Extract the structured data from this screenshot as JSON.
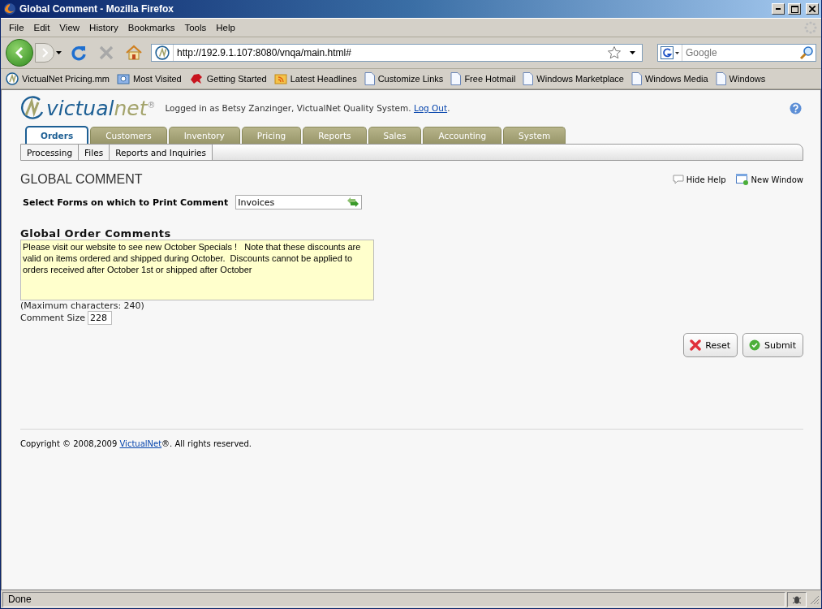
{
  "window": {
    "title": "Global Comment - Mozilla Firefox"
  },
  "menu": [
    "File",
    "Edit",
    "View",
    "History",
    "Bookmarks",
    "Tools",
    "Help"
  ],
  "address": {
    "value": "http://192.9.1.107:8080/vnqa/main.html#"
  },
  "search": {
    "placeholder": "Google"
  },
  "bookmarks": [
    {
      "kind": "logo",
      "label": "VictualNet Pricing.mm"
    },
    {
      "kind": "folder",
      "label": "Most Visited"
    },
    {
      "kind": "creature",
      "label": "Getting Started"
    },
    {
      "kind": "feed",
      "label": "Latest Headlines"
    },
    {
      "kind": "page",
      "label": "Customize Links"
    },
    {
      "kind": "page",
      "label": "Free Hotmail"
    },
    {
      "kind": "page",
      "label": "Windows Marketplace"
    },
    {
      "kind": "page",
      "label": "Windows Media"
    },
    {
      "kind": "page",
      "label": "Windows"
    }
  ],
  "header": {
    "logo": {
      "name": "victual",
      "suffix": "net",
      "mark": "®"
    },
    "login": {
      "text": "Logged in as Betsy Zanzinger, VictualNet Quality System.",
      "link": "Log Out",
      "after": "."
    }
  },
  "tabs": [
    {
      "label": "Orders",
      "selected": true
    },
    {
      "label": "Customers",
      "selected": false
    },
    {
      "label": "Inventory",
      "selected": false
    },
    {
      "label": "Pricing",
      "selected": false
    },
    {
      "label": "Reports",
      "selected": false
    },
    {
      "label": "Sales",
      "selected": false
    },
    {
      "label": "Accounting",
      "selected": false
    },
    {
      "label": "System",
      "selected": false
    }
  ],
  "subtabs": [
    "Processing",
    "Files",
    "Reports and Inquiries"
  ],
  "page": {
    "title": "GLOBAL COMMENT",
    "hide_help": "Hide Help",
    "new_window": "New Window",
    "forms_label": "Select Forms on which to Print Comment",
    "forms_value": "Invoices",
    "comments_heading": "Global Order Comments",
    "comment": "Please visit our website to see new October Specials !   Note that these discounts are valid on items ordered and shipped during October.  Discounts cannot be applied to orders received after October 1st or shipped after October",
    "max_note": "(Maximum characters: 240)",
    "size_label": "Comment Size",
    "size_value": "228",
    "buttons": [
      {
        "kind": "reset",
        "label": "Reset"
      },
      {
        "kind": "submit",
        "label": "Submit"
      }
    ]
  },
  "footer": {
    "text": "Copyright © 2008,2009",
    "link": "VictualNet",
    "after": "®. All rights reserved."
  },
  "status_bar": {
    "text": "Done"
  }
}
